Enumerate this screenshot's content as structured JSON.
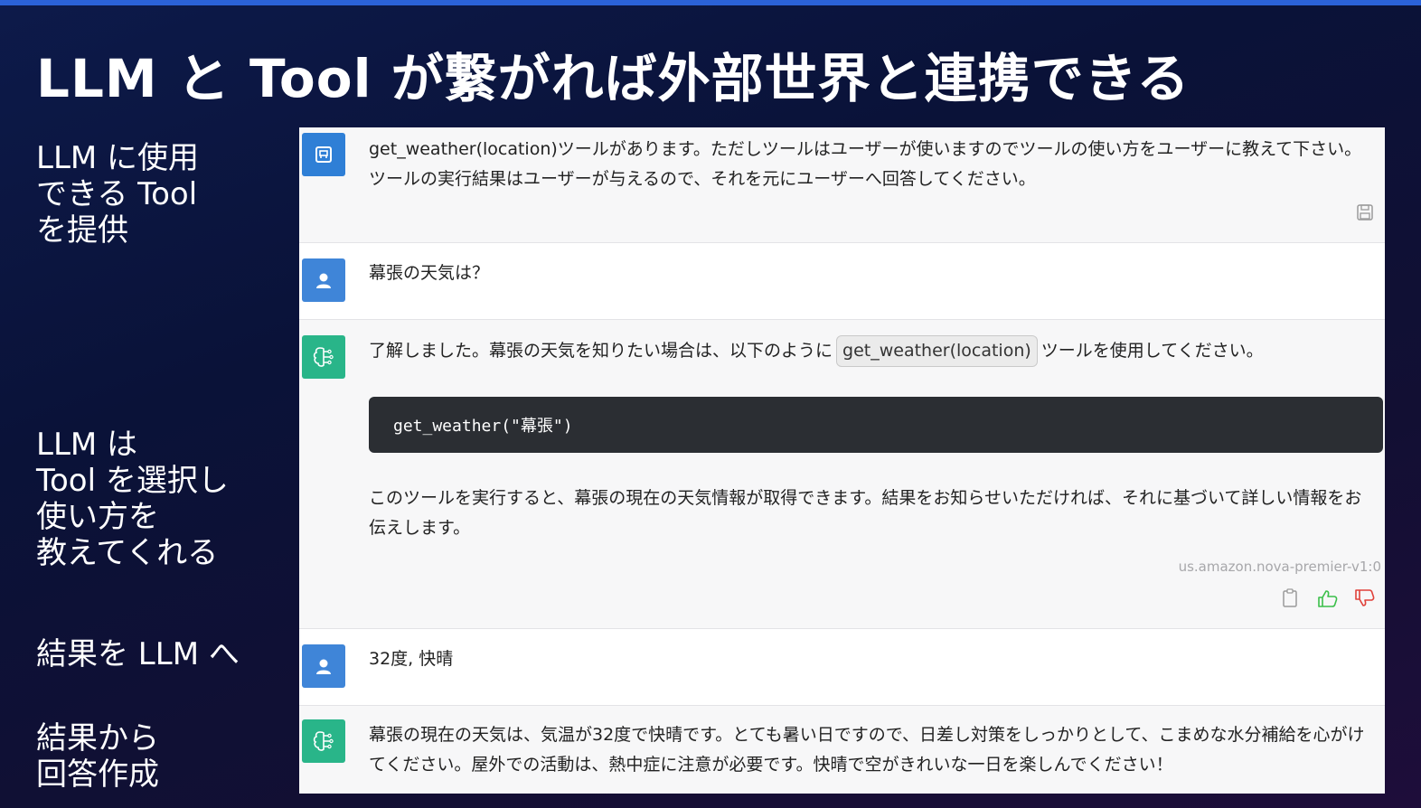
{
  "slide": {
    "title": "LLM と Tool が繋がれば外部世界と連携できる",
    "labels": [
      "LLM に使用\nできる Tool\nを提供",
      "LLM は\nTool を選択し\n使い方を\n教えてくれる",
      "結果を LLM へ",
      "結果から\n回答作成"
    ]
  },
  "chat": {
    "system_prompt": "get_weather(location)ツールがあります。ただしツールはユーザーが使いますのでツールの使い方をユーザーに教えて下さい。ツールの実行結果はユーザーが与えるので、それを元にユーザーへ回答してください。",
    "user_message_1": "幕張の天気は？",
    "assistant_1": {
      "intro_before": "了解しました。幕張の天気を知りたい場合は、以下のように",
      "inline_code": "get_weather(location)",
      "intro_after": "ツールを使用してください。",
      "code": "get_weather(\"幕張\")",
      "followup": "このツールを実行すると、幕張の現在の天気情報が取得できます。結果をお知らせいただければ、それに基づいて詳しい情報をお伝えします。",
      "model_id": "us.amazon.nova-premier-v1:0"
    },
    "user_message_2": "32度, 快晴",
    "assistant_2": "幕張の現在の天気は、気温が32度で快晴です。とても暑い日ですので、日差し対策をしっかりとして、こまめな水分補給を心がけてください。屋外での活動は、熱中症に注意が必要です。快晴で空がきれいな一日を楽しんでください！"
  },
  "icons": {
    "system": "system-prompt-icon",
    "user": "user-icon",
    "assistant": "brain-icon",
    "save": "save-icon",
    "copy": "clipboard-icon",
    "like": "thumbs-up-icon",
    "dislike": "thumbs-down-icon"
  },
  "colors": {
    "accent_bar": "#2b62d8",
    "system_avatar": "#2f7fd6",
    "user_avatar": "#3f85d8",
    "assistant_avatar": "#29b589",
    "like": "#3bbf4a",
    "dislike": "#e0413a",
    "code_bg": "#2b2e33"
  }
}
